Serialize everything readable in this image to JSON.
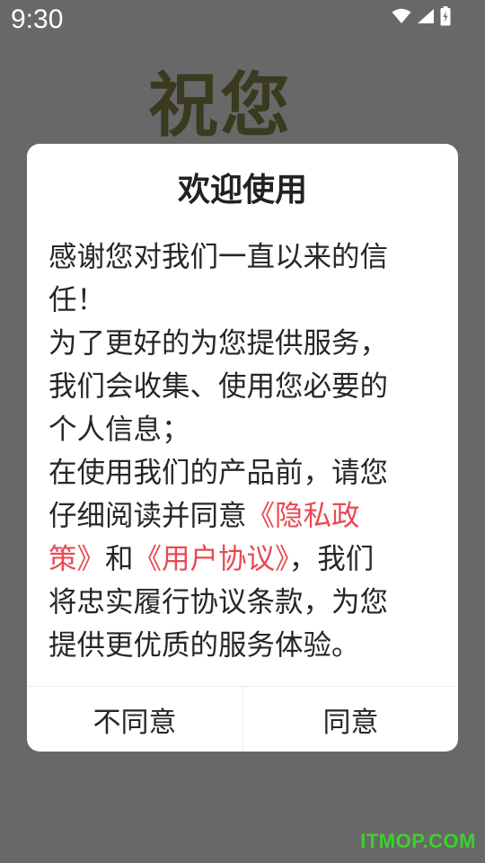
{
  "status_bar": {
    "time": "9:30",
    "icons": [
      "wifi-icon",
      "cellular-signal-icon",
      "battery-charging-icon"
    ]
  },
  "background": {
    "headline": "祝您"
  },
  "dialog": {
    "title": "欢迎使用",
    "body_lines": [
      {
        "before": "感谢您对我们一直以来的信",
        "link": "",
        "after": ""
      },
      {
        "before": "任！",
        "link": "",
        "after": ""
      },
      {
        "before": "为了更好的为您提供服务，",
        "link": "",
        "after": ""
      },
      {
        "before": "我们会收集、使用您必要的",
        "link": "",
        "after": ""
      },
      {
        "before": "个人信息；",
        "link": "",
        "after": ""
      },
      {
        "before": "在使用我们的产品前，请您",
        "link": "",
        "after": ""
      },
      {
        "before": "仔细阅读并同意",
        "link": "《隐私政",
        "after": ""
      },
      {
        "before": "",
        "link": "策》",
        "after": "和",
        "link2": "《用户协议》",
        "after2": "，我们"
      },
      {
        "before": "将忠实履行协议条款，为您",
        "link": "",
        "after": ""
      },
      {
        "before": "提供更优质的服务体验。",
        "link": "",
        "after": ""
      }
    ],
    "decline_label": "不同意",
    "agree_label": "同意"
  },
  "colors": {
    "link": "#e84a52",
    "overlay": "#686868",
    "watermark": "#3ad12b"
  },
  "watermark": "ITMOP.COM"
}
